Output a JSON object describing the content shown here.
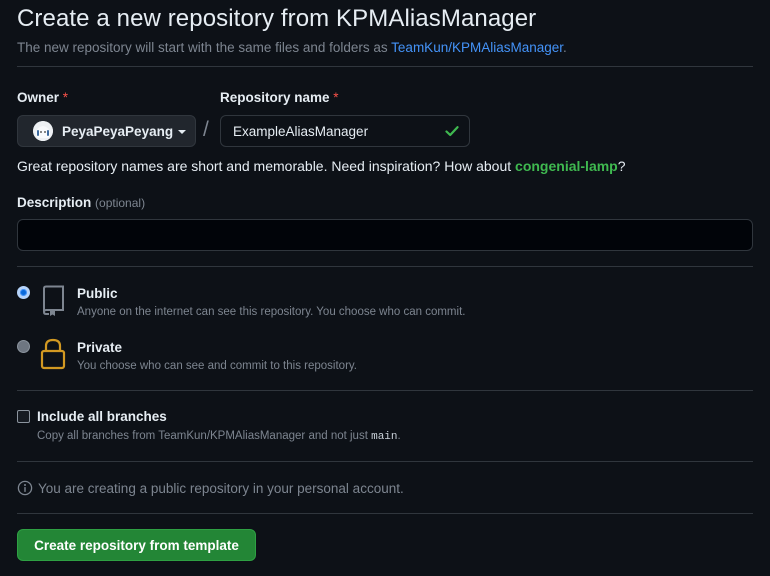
{
  "header": {
    "title": "Create a new repository from KPMAliasManager",
    "subtitle_prefix": "The new repository will start with the same files and folders as ",
    "template_link": "TeamKun/KPMAliasManager",
    "subtitle_suffix": "."
  },
  "owner": {
    "label": "Owner",
    "required_mark": "*",
    "selected": "PeyaPeyaPeyang"
  },
  "separator": "/",
  "repo_name": {
    "label": "Repository name",
    "required_mark": "*",
    "value": "ExampleAliasManager",
    "valid": true
  },
  "name_hint": {
    "prefix": "Great repository names are short and memorable. Need inspiration? How about ",
    "suggestion": "congenial-lamp",
    "suffix": "?"
  },
  "description": {
    "label": "Description",
    "optional_text": "(optional)",
    "value": "",
    "placeholder": ""
  },
  "visibility": {
    "options": [
      {
        "title": "Public",
        "description": "Anyone on the internet can see this repository. You choose who can commit.",
        "checked": true,
        "icon": "repo-icon"
      },
      {
        "title": "Private",
        "description": "You choose who can see and commit to this repository.",
        "checked": false,
        "icon": "lock-icon"
      }
    ]
  },
  "include_branches": {
    "title": "Include all branches",
    "description_prefix": "Copy all branches from TeamKun/KPMAliasManager and not just ",
    "description_code": "main",
    "description_suffix": ".",
    "checked": false
  },
  "notice": {
    "icon": "info-icon",
    "text": "You are creating a public repository in your personal account."
  },
  "submit": {
    "label": "Create repository from template"
  },
  "colors": {
    "background": "#0d1117",
    "accent_link": "#4493f8",
    "success": "#3fb950",
    "primary_button": "#238636",
    "required": "#f85149",
    "lock_icon": "#d29922"
  }
}
